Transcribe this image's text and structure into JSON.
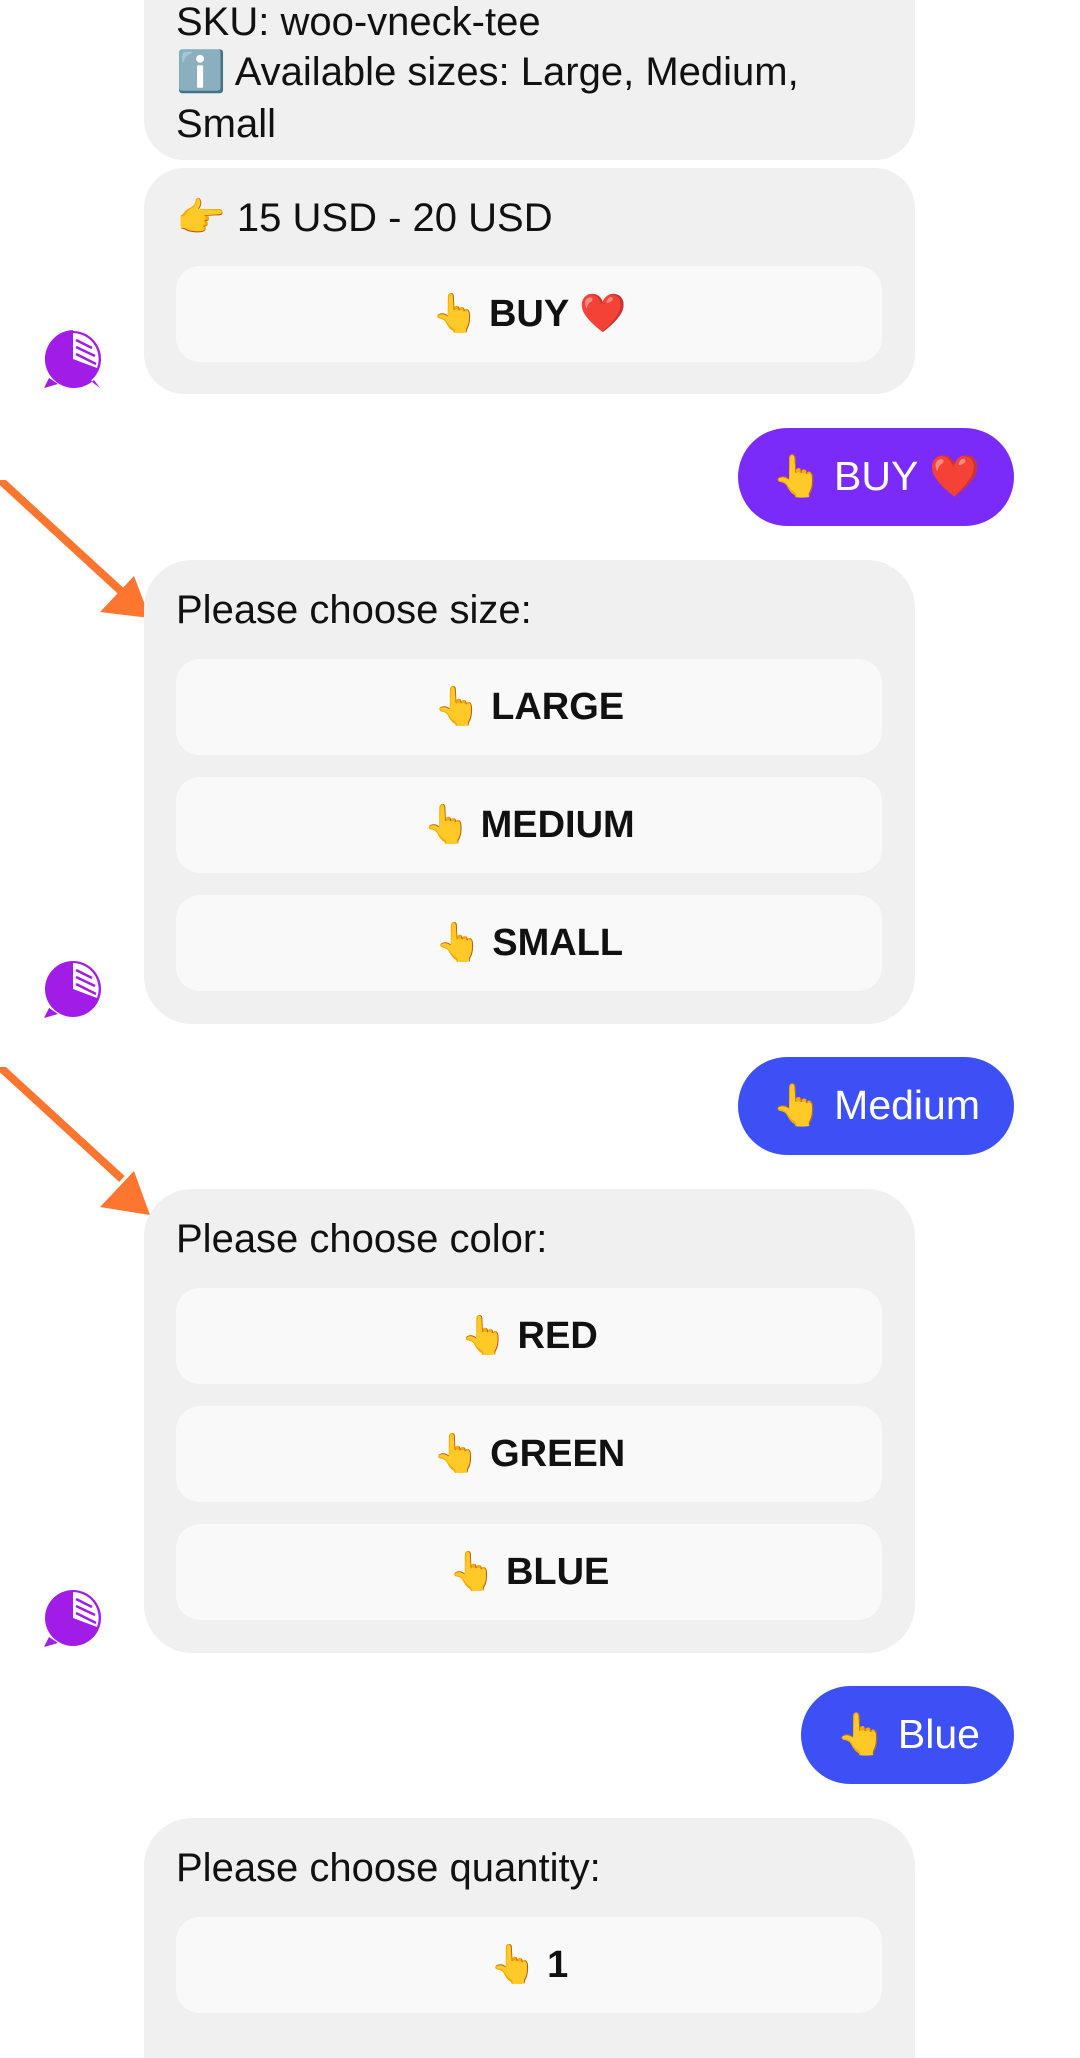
{
  "colors": {
    "bot_bubble": "#f0f0f0",
    "quick_reply_bg": "#f9f9f9",
    "user_purple": "#7b2bf9",
    "user_blue": "#3d50f6",
    "arrow": "#fd7630",
    "avatar": "#a21ce8"
  },
  "product_card": {
    "sku_line": "SKU: woo-vneck-tee",
    "sizes_line": "ℹ️ Available sizes: Large, Medium, Small",
    "price_line": "👉 15 USD - 20 USD",
    "buy_button": {
      "emoji": "👆",
      "label": "BUY ❤️"
    }
  },
  "user_messages": {
    "buy": "👆 BUY ❤️",
    "size": "👆 Medium",
    "color": "👆 Blue"
  },
  "size_prompt": {
    "question": "Please choose size:",
    "options": [
      {
        "emoji": "👆",
        "label": "LARGE"
      },
      {
        "emoji": "👆",
        "label": "MEDIUM"
      },
      {
        "emoji": "👆",
        "label": "SMALL"
      }
    ]
  },
  "color_prompt": {
    "question": "Please choose color:",
    "options": [
      {
        "emoji": "👆",
        "label": "RED"
      },
      {
        "emoji": "👆",
        "label": "GREEN"
      },
      {
        "emoji": "👆",
        "label": "BLUE"
      }
    ]
  },
  "quantity_prompt": {
    "question": "Please choose quantity:",
    "options": [
      {
        "emoji": "👆",
        "label": "1"
      }
    ]
  }
}
